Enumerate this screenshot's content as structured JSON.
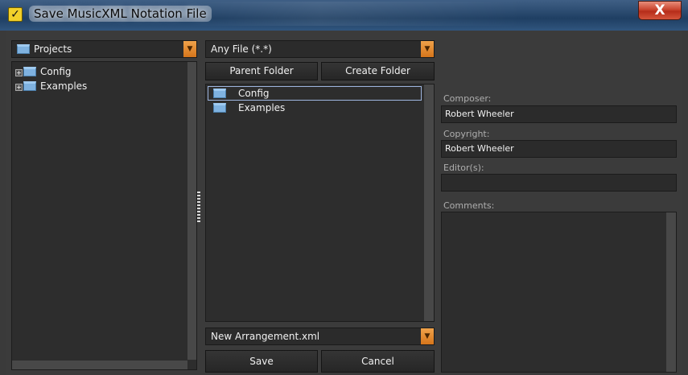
{
  "window": {
    "title": "Save MusicXML Notation File",
    "close_label": "X"
  },
  "left": {
    "location_dropdown": "Projects",
    "tree": [
      {
        "label": "Config"
      },
      {
        "label": "Examples"
      }
    ]
  },
  "middle": {
    "filter_dropdown": "Any File (*.*)",
    "parent_folder_label": "Parent Folder",
    "create_folder_label": "Create Folder",
    "files": [
      {
        "label": "Config"
      },
      {
        "label": "Examples"
      }
    ],
    "filename_value": "New Arrangement.xml",
    "save_label": "Save",
    "cancel_label": "Cancel"
  },
  "right": {
    "composer_label": "Composer:",
    "composer_value": "Robert Wheeler",
    "copyright_label": "Copyright:",
    "copyright_value": "Robert Wheeler",
    "editors_label": "Editor(s):",
    "editors_value": "",
    "comments_label": "Comments:",
    "comments_value": ""
  },
  "colors": {
    "accent_orange": "#e08a2c",
    "panel_bg": "#2d2d2d",
    "dialog_bg": "#3b3b3b"
  }
}
